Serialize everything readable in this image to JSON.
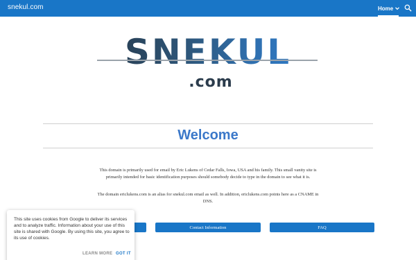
{
  "topbar": {
    "site_title": "snekul.com",
    "nav_home": "Home",
    "icons": [
      "chevron-down-icon",
      "search-icon"
    ],
    "bar_color": "#1976c7"
  },
  "logo": {
    "main": "SNEKUL",
    "sub": ".com"
  },
  "heading": "Welcome",
  "paragraphs": {
    "p1": "This domain is primarily used for email by Eric Lukens of Cedar Falls, Iowa, USA and his family. This small vanity site is primarily intended for basic identification purposes should somebody decide to type in the domain to see what it is.",
    "p2": "The domain ericlukens.com is an alias for snekul.com email as well. In addition, ericlukens.com points here as a CNAME in DNS."
  },
  "buttons": {
    "b1": "",
    "b2": "Contact Information",
    "b3": "FAQ"
  },
  "cookie_banner": {
    "text": "This site uses cookies from Google to deliver its services and to analyze traffic. Information about your use of this site is shared with Google. By using this site, you agree to its use of cookies.",
    "learn_more": "LEARN MORE",
    "got_it": "GOT IT"
  },
  "colors": {
    "accent": "#1976c7",
    "heading": "#3b78c9"
  }
}
